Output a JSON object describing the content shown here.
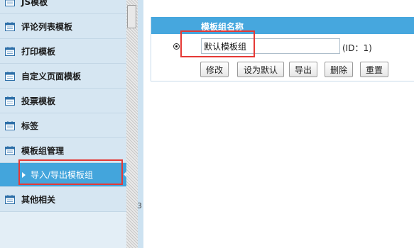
{
  "sidebar": {
    "items": [
      {
        "label": "JS模板"
      },
      {
        "label": "评论列表模板"
      },
      {
        "label": "打印模板"
      },
      {
        "label": "自定义页面模板"
      },
      {
        "label": "投票模板"
      },
      {
        "label": "标签"
      },
      {
        "label": "模板组管理"
      }
    ],
    "active_sub": {
      "label": "导入/导出模板组"
    },
    "last_item": {
      "label": "其他相关"
    }
  },
  "stray_text": "3",
  "main": {
    "column_header": "模板组名称",
    "row": {
      "name_value": "默认模板组",
      "id_label": "(ID：1)",
      "selected": true
    },
    "buttons": {
      "edit": "修改",
      "set_default": "设为默认",
      "export": "导出",
      "delete": "删除",
      "reset": "重置"
    }
  },
  "colors": {
    "highlight": "#e53935",
    "header_bar": "#46a7de",
    "active_nav": "#43a5dc"
  }
}
